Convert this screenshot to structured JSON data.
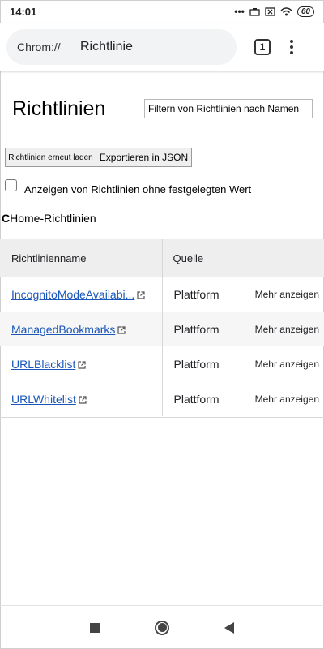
{
  "status_bar": {
    "time": "14:01",
    "battery": "60",
    "icons": [
      "dots-icon",
      "notification-icon",
      "sim-off-icon",
      "wifi-icon",
      "battery-icon"
    ]
  },
  "browser": {
    "scheme": "Chrom://",
    "page": "Richtlinie",
    "tab_count": "1"
  },
  "page": {
    "title": "Richtlinien",
    "filter_placeholder": "Filtern von Richtlinien nach Namen",
    "reload_button": "Richtlinien erneut laden",
    "export_button": "Exportieren in JSON",
    "show_unset_label": "Anzeigen von Richtlinien ohne festgelegten Wert",
    "section_prefix": "C",
    "section_title": "Home-Richtlinien"
  },
  "table": {
    "headers": {
      "name": "Richtlinienname",
      "source": "Quelle"
    },
    "rows": [
      {
        "name": "IncognitoModeAvailabi...",
        "source": "Plattform",
        "more": "Mehr anzeigen"
      },
      {
        "name": "ManagedBookmarks",
        "source": "Plattform",
        "more": "Mehr anzeigen"
      },
      {
        "name": "URLBlacklist",
        "source": "Plattform",
        "more": "Mehr anzeigen"
      },
      {
        "name": "URLWhitelist",
        "source": "Plattform",
        "more": "Mehr anzeigen"
      }
    ]
  },
  "colors": {
    "link": "#1a57b8",
    "header_bg": "#eeeeee",
    "omnibox_bg": "#f1f3f4"
  }
}
